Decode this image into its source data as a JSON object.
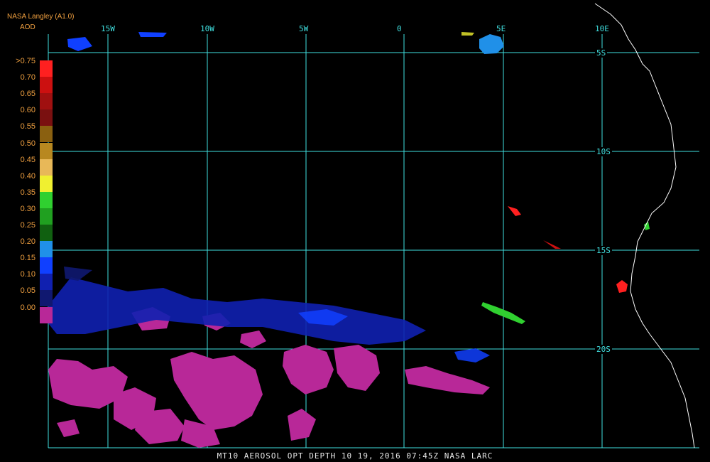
{
  "header": {
    "source": "NASA Langley (A1.0)",
    "product": "AOD"
  },
  "legend": [
    {
      "label": ">0.75",
      "color": "#ff2020"
    },
    {
      "label": "0.70",
      "color": "#cc1010"
    },
    {
      "label": "0.65",
      "color": "#a01010"
    },
    {
      "label": "0.60",
      "color": "#7a1010"
    },
    {
      "label": "0.55",
      "color": "#8a6010"
    },
    {
      "label": "0.50",
      "color": "#b88820"
    },
    {
      "label": "0.45",
      "color": "#e8b858"
    },
    {
      "label": "0.40",
      "color": "#f0f030"
    },
    {
      "label": "0.35",
      "color": "#30d030"
    },
    {
      "label": "0.30",
      "color": "#20a020"
    },
    {
      "label": "0.25",
      "color": "#106010"
    },
    {
      "label": "0.20",
      "color": "#2090e8"
    },
    {
      "label": "0.15",
      "color": "#1040ff"
    },
    {
      "label": "0.10",
      "color": "#1020b0"
    },
    {
      "label": "0.05",
      "color": "#101870"
    },
    {
      "label": "0.00",
      "color": "#b82898"
    }
  ],
  "lon_labels": [
    "15W",
    "10W",
    "5W",
    "0",
    "5E",
    "10E"
  ],
  "lat_labels": [
    "5S",
    "10S",
    "15S",
    "20S"
  ],
  "footer": "MT10  AEROSOL OPT DEPTH   10 19, 2016 07:45Z   NASA LARC",
  "colors": {
    "grid": "#40e0e0",
    "label": "#f0a040",
    "coast": "#ffffff"
  }
}
